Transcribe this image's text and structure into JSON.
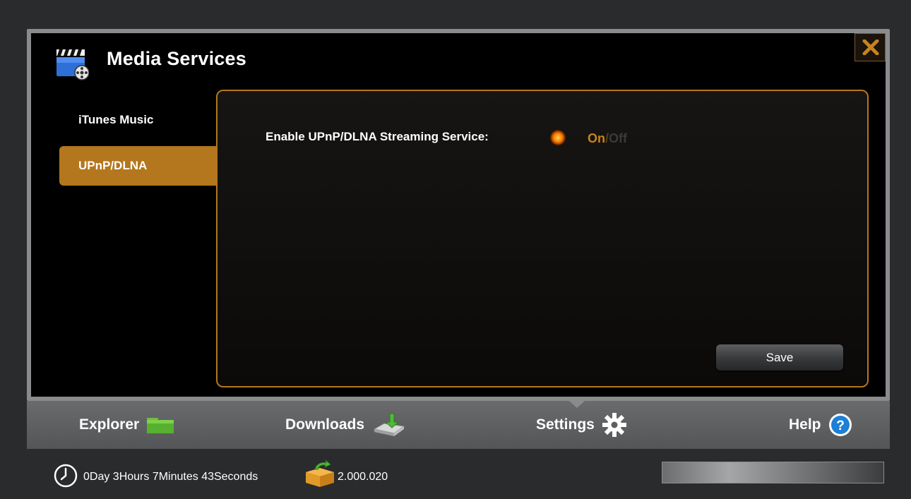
{
  "window": {
    "title": "Media Services"
  },
  "sidebar": {
    "items": [
      {
        "label": "iTunes Music",
        "selected": false
      },
      {
        "label": "UPnP/DLNA",
        "selected": true
      }
    ]
  },
  "settings": {
    "upnp_label": "Enable UPnP/DLNA Streaming Service:",
    "toggle_on": "On",
    "toggle_sep": "/",
    "toggle_off": "Off",
    "enabled": true
  },
  "buttons": {
    "save": "Save"
  },
  "nav": {
    "explorer": "Explorer",
    "downloads": "Downloads",
    "settings": "Settings",
    "help": "Help",
    "active": "Settings"
  },
  "status": {
    "uptime": "0Day 3Hours 7Minutes 43Seconds",
    "counter": "2.000.020"
  },
  "colors": {
    "accent": "#b4771d",
    "help_blue": "#1e7fd6"
  },
  "icons": [
    "media-services-icon",
    "close-icon",
    "folder-icon",
    "download-drive-icon",
    "gear-icon",
    "help-icon",
    "clock-icon",
    "box-arrow-icon"
  ]
}
